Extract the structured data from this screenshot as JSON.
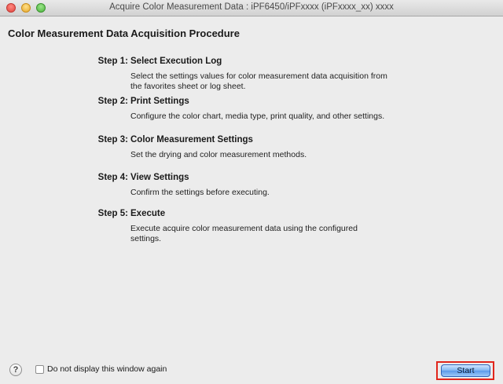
{
  "window": {
    "title": "Acquire Color Measurement Data : iPF6450/iPFxxxx (iPFxxxx_xx) xxxx"
  },
  "main": {
    "heading": "Color Measurement Data Acquisition Procedure",
    "steps": [
      {
        "number": "Step 1:",
        "name": "Select Execution Log",
        "description": "Select the settings values for color measurement data acquisition from the favorites sheet or log sheet."
      },
      {
        "number": "Step 2:",
        "name": "Print Settings",
        "description": "Configure the color chart, media type, print quality, and other settings."
      },
      {
        "number": "Step 3:",
        "name": "Color Measurement Settings",
        "description": "Set the drying and color measurement methods."
      },
      {
        "number": "Step 4:",
        "name": "View Settings",
        "description": "Confirm the settings before executing."
      },
      {
        "number": "Step 5:",
        "name": "Execute",
        "description": "Execute acquire color measurement data using the configured settings."
      }
    ]
  },
  "footer": {
    "help_icon": "?",
    "checkbox_label": "Do not display this window again",
    "checkbox_checked": false,
    "start_label": "Start"
  },
  "colors": {
    "highlight": "#e1261c",
    "start_button": "#5b9ae9"
  }
}
